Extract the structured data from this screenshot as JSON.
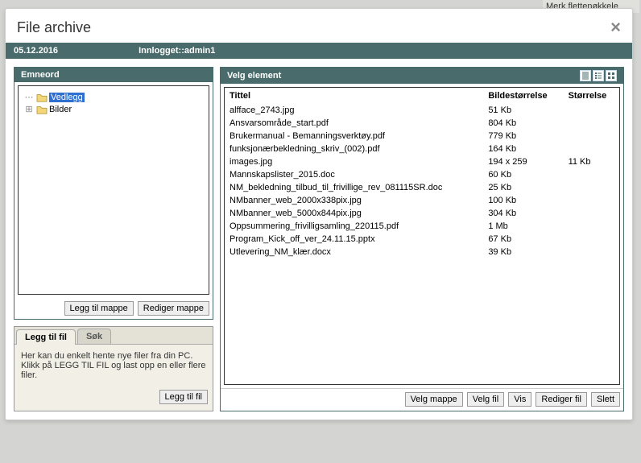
{
  "background": {
    "top_right_text": "Merk flettenøkkele"
  },
  "modal": {
    "title": "File archive",
    "close": "×"
  },
  "status_bar": {
    "date": "05.12.2016",
    "login": "Innlogget::admin1"
  },
  "emneord": {
    "title": "Emneord",
    "tree": [
      {
        "label": "Vedlegg",
        "selected": true,
        "expandable": false
      },
      {
        "label": "Bilder",
        "selected": false,
        "expandable": true
      }
    ],
    "btn_add": "Legg til mappe",
    "btn_edit": "Rediger mappe"
  },
  "tabs": {
    "add_label": "Legg til fil",
    "search_label": "Søk",
    "help_text": "Her kan du enkelt hente nye filer fra din PC. Klikk på LEGG TIL FIL og last opp en eller flere filer.",
    "btn_add_file": "Legg til fil"
  },
  "files_panel": {
    "title": "Velg element",
    "headers": {
      "title": "Tittel",
      "image_size": "Bildestørrelse",
      "size": "Størrelse"
    },
    "rows": [
      {
        "name": "alfface_2743.jpg",
        "img": "51 Kb",
        "size": ""
      },
      {
        "name": "Ansvarsområde_start.pdf",
        "img": "804 Kb",
        "size": ""
      },
      {
        "name": "Brukermanual - Bemanningsverktøy.pdf",
        "img": "779 Kb",
        "size": ""
      },
      {
        "name": "funksjonærbekledning_skriv_(002).pdf",
        "img": "164 Kb",
        "size": ""
      },
      {
        "name": "images.jpg",
        "img": "194 x 259",
        "size": "11 Kb"
      },
      {
        "name": "Mannskapslister_2015.doc",
        "img": "60 Kb",
        "size": ""
      },
      {
        "name": "NM_bekledning_tilbud_til_frivillige_rev_081115SR.doc",
        "img": "25 Kb",
        "size": ""
      },
      {
        "name": "NMbanner_web_2000x338pix.jpg",
        "img": "100 Kb",
        "size": ""
      },
      {
        "name": "NMbanner_web_5000x844pix.jpg",
        "img": "304 Kb",
        "size": ""
      },
      {
        "name": "Oppsummering_frivilligsamling_220115.pdf",
        "img": "1 Mb",
        "size": ""
      },
      {
        "name": "Program_Kick_off_ver_24.11.15.pptx",
        "img": "67 Kb",
        "size": ""
      },
      {
        "name": "Utlevering_NM_klær.docx",
        "img": "39 Kb",
        "size": ""
      }
    ],
    "footer_btns": {
      "select_folder": "Velg mappe",
      "select_file": "Velg fil",
      "view": "Vis",
      "edit_file": "Rediger fil",
      "delete": "Slett"
    }
  }
}
